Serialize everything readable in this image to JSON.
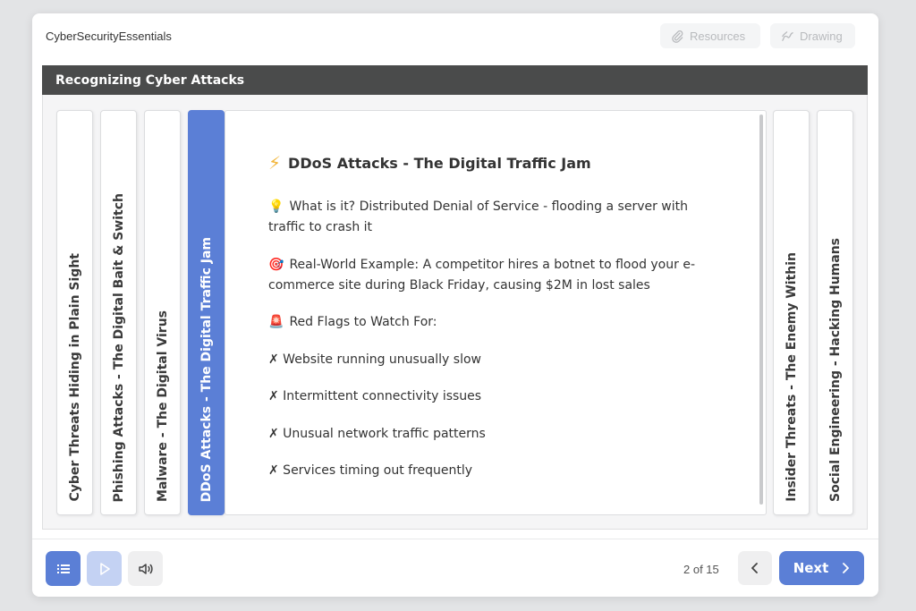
{
  "app": {
    "title": "CyberSecurityEssentials"
  },
  "toolbar": {
    "resources_label": "Resources",
    "drawing_label": "Drawing"
  },
  "lesson": {
    "title": "Recognizing Cyber Attacks"
  },
  "tabs": [
    {
      "label": "Cyber Threats Hiding in Plain Sight",
      "active": false
    },
    {
      "label": "Phishing Attacks - The Digital Bait & Switch",
      "active": false
    },
    {
      "label": "Malware - The Digital Virus",
      "active": false
    },
    {
      "label": "DDoS Attacks - The Digital Traffic Jam",
      "active": true
    },
    {
      "label": "Insider Threats - The Enemy Within",
      "active": false
    },
    {
      "label": "Social Engineering - Hacking Humans",
      "active": false
    }
  ],
  "content": {
    "title_icon": "⚡",
    "title": "DDoS  Attacks - The Digital Traffic Jam",
    "what_icon": "💡",
    "what": "What is it? Distributed Denial of Service - flooding a server with traffic to crash it",
    "example_icon": "🎯",
    "example": "Real-World Example: A competitor hires a botnet to flood your e-commerce site during Black Friday, causing $2M in lost sales",
    "flags_icon": "🚨",
    "flags_heading": "Red Flags to Watch For:",
    "flags": [
      "✗ Website running unusually slow",
      "✗ Intermittent connectivity issues",
      "✗ Unusual network traffic patterns",
      "✗ Services timing out frequently"
    ]
  },
  "footer": {
    "page_indicator": "2 of 15",
    "next_label": "Next"
  },
  "colors": {
    "accent": "#5b7fd6",
    "lesson_bar": "#4a4b4b",
    "accent_light": "#c4d2f3"
  }
}
